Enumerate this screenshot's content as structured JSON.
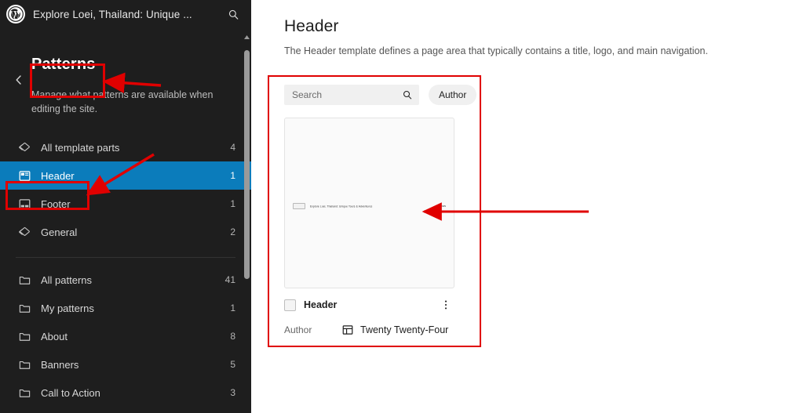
{
  "sidebar": {
    "topbar": {
      "logo_icon": "wordpress-logo-icon",
      "site_title": "Explore Loei, Thailand: Unique ...",
      "search_icon": "search-icon"
    },
    "back_icon": "chevron-left-icon",
    "panel_title": "Patterns",
    "panel_description": "Manage what patterns are available when editing the site.",
    "template_parts": [
      {
        "label": "All template parts",
        "count": "4",
        "icon": "layers-icon",
        "active": false
      },
      {
        "label": "Header",
        "count": "1",
        "icon": "header-layout-icon",
        "active": true
      },
      {
        "label": "Footer",
        "count": "1",
        "icon": "footer-layout-icon",
        "active": false
      },
      {
        "label": "General",
        "count": "2",
        "icon": "layers-icon",
        "active": false
      }
    ],
    "patterns": [
      {
        "label": "All patterns",
        "count": "41",
        "icon": "folder-icon"
      },
      {
        "label": "My patterns",
        "count": "1",
        "icon": "folder-icon"
      },
      {
        "label": "About",
        "count": "8",
        "icon": "folder-icon"
      },
      {
        "label": "Banners",
        "count": "5",
        "icon": "folder-icon"
      },
      {
        "label": "Call to Action",
        "count": "3",
        "icon": "folder-icon"
      }
    ]
  },
  "main": {
    "title": "Header",
    "description": "The Header template defines a page area that typically contains a title, logo, and main navigation.",
    "search": {
      "placeholder": "Search",
      "value": "",
      "icon": "search-icon"
    },
    "author_filter": {
      "label": "Author",
      "icon": "chevron-down-icon"
    },
    "card": {
      "preview": {
        "mini_logo_icon": "site-logo-icon",
        "mini_title": "Explore Loei, Thailand: Unique Tours & Adventures",
        "mini_nav": "Tours"
      },
      "checkbox_checked": false,
      "name": "Header",
      "menu_icon": "kebab-menu-icon",
      "meta_label": "Author",
      "meta_icon": "template-part-icon",
      "meta_value": "Twenty Twenty-Four"
    }
  },
  "annotations": {
    "color": "#e00000",
    "box_patterns_title": "highlight-patterns-title",
    "box_header_nav": "highlight-header-nav-item",
    "box_pattern_card": "highlight-pattern-card",
    "arrow_to_patterns": "arrow-pointing-to-patterns-title",
    "arrow_to_header": "arrow-pointing-to-header-nav-item",
    "arrow_to_preview": "arrow-pointing-to-pattern-preview"
  },
  "colors": {
    "sidebar_bg": "#1e1e1e",
    "active_nav": "#0b7cbb",
    "annotation_red": "#e00000"
  }
}
